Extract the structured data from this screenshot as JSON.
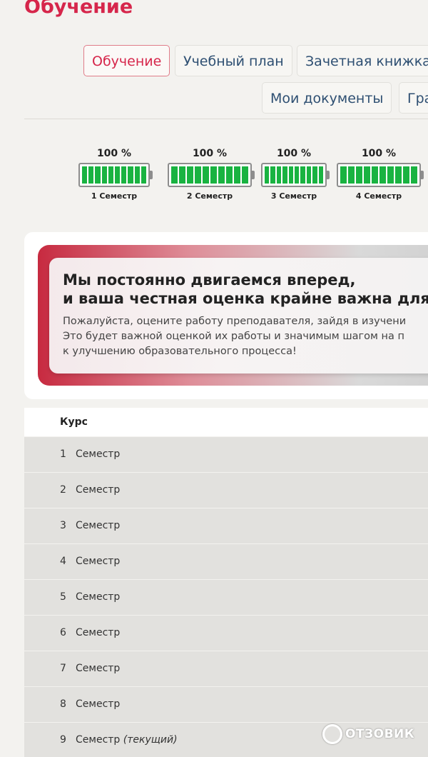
{
  "page": {
    "title": "Обучение"
  },
  "tabs": [
    {
      "label": "Обучение",
      "active": true
    },
    {
      "label": "Учебный план",
      "active": false
    },
    {
      "label": "Зачетная книжка",
      "active": false
    },
    {
      "label": "Мои документы",
      "active": false
    },
    {
      "label": "Гра",
      "active": false
    }
  ],
  "progress": [
    {
      "percent": "100 %",
      "label": "1 Семестр",
      "fill": 1.0
    },
    {
      "percent": "100 %",
      "label": "2 Семестр",
      "fill": 1.0
    },
    {
      "percent": "100 %",
      "label": "3 Семестр",
      "fill": 1.0
    },
    {
      "percent": "100 %",
      "label": "4 Семестр",
      "fill": 1.0
    }
  ],
  "banner": {
    "heading_line1": "Мы постоянно двигаемся вперед,",
    "heading_line2": "и ваша честная оценка крайне важна для нас",
    "body_line1": "Пожалуйста, оцените работу преподавателя, зайдя в изучени",
    "body_line2": "Это будет важной оценкой их работы и значимым шагом на п",
    "body_line3": "к улучшению образовательного процесса!"
  },
  "table": {
    "header": "Курс",
    "rows": [
      {
        "num": "1",
        "label": "Семестр",
        "note": ""
      },
      {
        "num": "2",
        "label": "Семестр",
        "note": ""
      },
      {
        "num": "3",
        "label": "Семестр",
        "note": ""
      },
      {
        "num": "4",
        "label": "Семестр",
        "note": ""
      },
      {
        "num": "5",
        "label": "Семестр",
        "note": ""
      },
      {
        "num": "6",
        "label": "Семестр",
        "note": ""
      },
      {
        "num": "7",
        "label": "Семестр",
        "note": ""
      },
      {
        "num": "8",
        "label": "Семестр",
        "note": ""
      },
      {
        "num": "9",
        "label": "Семестр",
        "note": "(текущий)"
      }
    ]
  },
  "watermark": {
    "text": "ОТЗОВИК"
  },
  "colors": {
    "accent": "#d6264b",
    "link": "#2e4f72",
    "battery_fill": "#19b341"
  }
}
